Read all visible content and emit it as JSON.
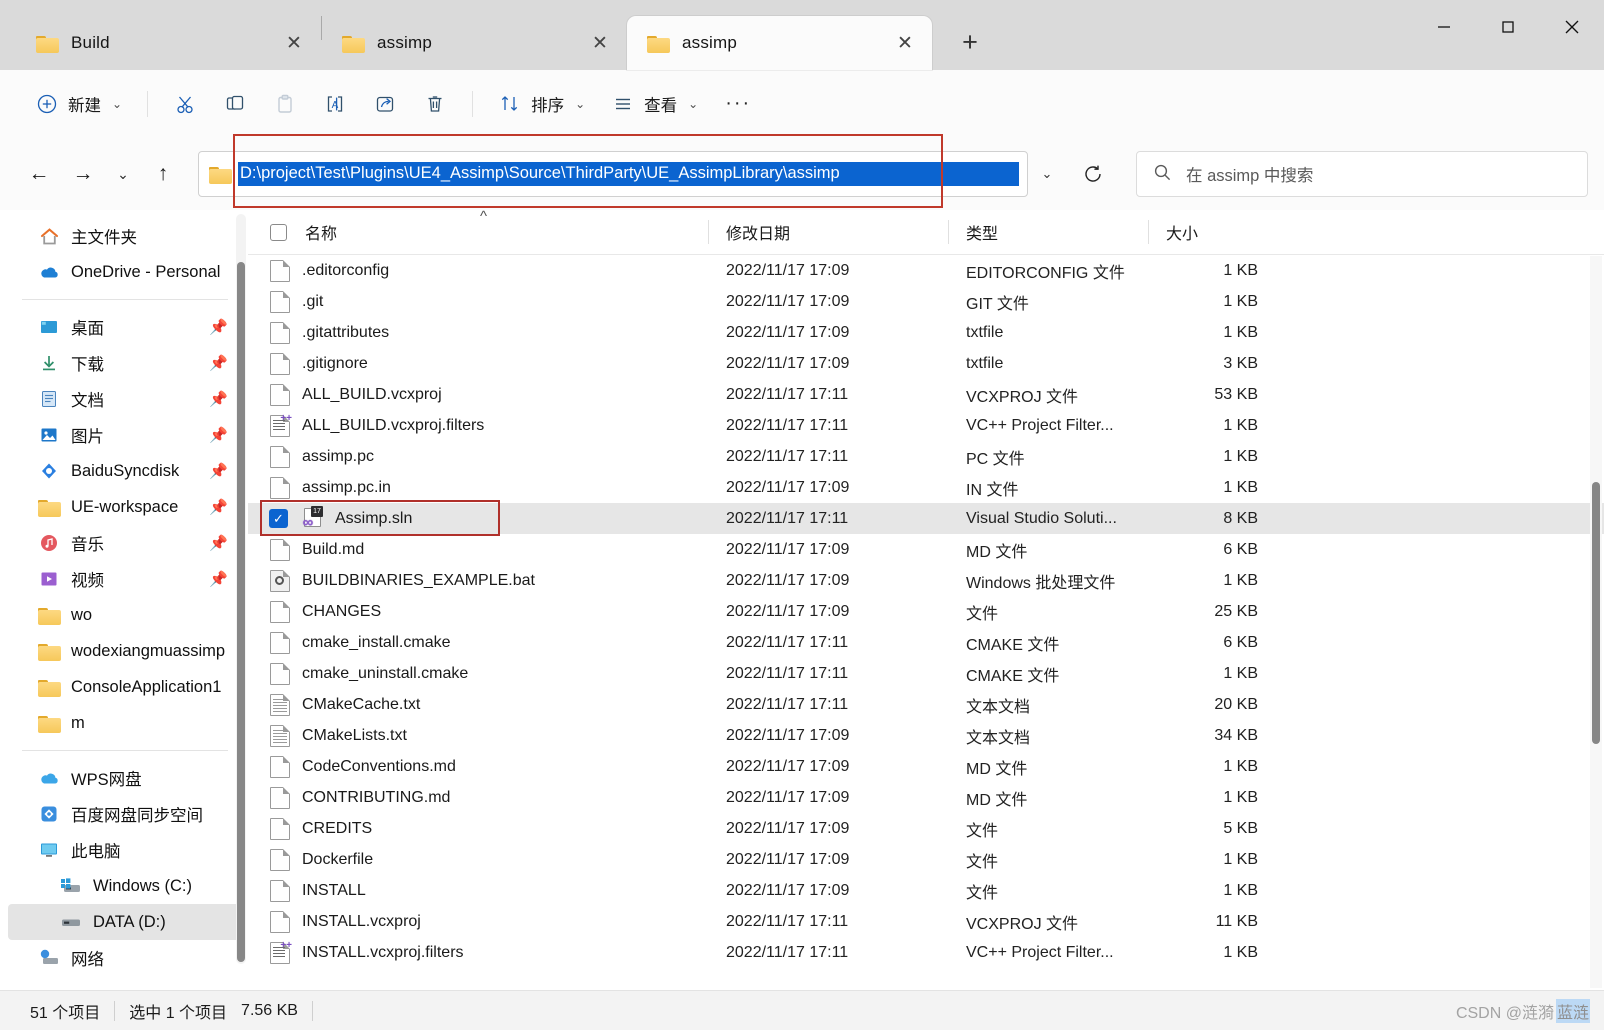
{
  "window": {
    "controls": {
      "minimize": "minimize-button",
      "maximize": "maximize-button",
      "close": "close-button"
    }
  },
  "tabs": [
    {
      "title": "Build",
      "icon": "folder-icon",
      "active": false
    },
    {
      "title": "assimp",
      "icon": "folder-icon",
      "active": false
    },
    {
      "title": "assimp",
      "icon": "folder-icon",
      "active": true
    }
  ],
  "new_tab_label": "+",
  "toolbar": {
    "new_label": "新建",
    "cut_label": "剪切",
    "copy_label": "复制",
    "paste_label": "粘贴",
    "rename_label": "重命名",
    "share_label": "共享",
    "delete_label": "删除",
    "sort_label": "排序",
    "view_label": "查看",
    "more_label": "···"
  },
  "navigation": {
    "back": "←",
    "forward": "→",
    "recent": "⌄",
    "up": "↑",
    "address_value": "D:\\project\\Test\\Plugins\\UE4_Assimp\\Source\\ThirdParty\\UE_AssimpLibrary\\assimp",
    "address_dropdown": "⌄",
    "refresh": "refresh-icon",
    "search_placeholder": "在 assimp 中搜索"
  },
  "sidebar": {
    "groups": [
      {
        "items": [
          {
            "label": "主文件夹",
            "icon": "home-icon",
            "pinned": false,
            "indent": false,
            "selected": false
          },
          {
            "label": "OneDrive - Personal",
            "icon": "onedrive-icon",
            "pinned": false,
            "indent": false,
            "selected": false
          }
        ]
      },
      {
        "items": [
          {
            "label": "桌面",
            "icon": "desktop-icon",
            "pinned": true,
            "indent": false,
            "selected": false
          },
          {
            "label": "下载",
            "icon": "downloads-icon",
            "pinned": true,
            "indent": false,
            "selected": false
          },
          {
            "label": "文档",
            "icon": "documents-icon",
            "pinned": true,
            "indent": false,
            "selected": false
          },
          {
            "label": "图片",
            "icon": "pictures-icon",
            "pinned": true,
            "indent": false,
            "selected": false
          },
          {
            "label": "BaiduSyncdisk",
            "icon": "baidu-icon",
            "pinned": true,
            "indent": false,
            "selected": false
          },
          {
            "label": "UE-workspace",
            "icon": "folder-icon",
            "pinned": true,
            "indent": false,
            "selected": false
          },
          {
            "label": "音乐",
            "icon": "music-icon",
            "pinned": true,
            "indent": false,
            "selected": false
          },
          {
            "label": "视频",
            "icon": "videos-icon",
            "pinned": true,
            "indent": false,
            "selected": false
          },
          {
            "label": "wo",
            "icon": "folder-icon",
            "pinned": false,
            "indent": false,
            "selected": false
          },
          {
            "label": "wodexiangmuassimp",
            "icon": "folder-icon",
            "pinned": false,
            "indent": false,
            "selected": false
          },
          {
            "label": "ConsoleApplication1",
            "icon": "folder-icon",
            "pinned": false,
            "indent": false,
            "selected": false
          },
          {
            "label": "m",
            "icon": "folder-shortcut-icon",
            "pinned": false,
            "indent": false,
            "selected": false
          }
        ]
      },
      {
        "items": [
          {
            "label": "WPS网盘",
            "icon": "wps-cloud-icon",
            "pinned": false,
            "indent": false,
            "selected": false
          },
          {
            "label": "百度网盘同步空间",
            "icon": "baidu-cloud-icon",
            "pinned": false,
            "indent": false,
            "selected": false
          },
          {
            "label": "此电脑",
            "icon": "this-pc-icon",
            "pinned": false,
            "indent": false,
            "selected": false
          },
          {
            "label": "Windows (C:)",
            "icon": "windows-drive-icon",
            "pinned": false,
            "indent": true,
            "selected": false
          },
          {
            "label": "DATA (D:)",
            "icon": "drive-icon",
            "pinned": false,
            "indent": true,
            "selected": true
          },
          {
            "label": "网络",
            "icon": "network-icon",
            "pinned": false,
            "indent": false,
            "selected": false
          }
        ]
      }
    ]
  },
  "file_list": {
    "columns": [
      "名称",
      "修改日期",
      "类型",
      "大小"
    ],
    "sort_indicator": "^",
    "rows": [
      {
        "name": ".editorconfig",
        "date": "2022/11/17 17:09",
        "type": "EDITORCONFIG 文件",
        "size": "1 KB",
        "icon": "file-icon",
        "selected": false,
        "checked": false
      },
      {
        "name": ".git",
        "date": "2022/11/17 17:09",
        "type": "GIT 文件",
        "size": "1 KB",
        "icon": "file-icon",
        "selected": false,
        "checked": false
      },
      {
        "name": ".gitattributes",
        "date": "2022/11/17 17:09",
        "type": "txtfile",
        "size": "1 KB",
        "icon": "file-icon",
        "selected": false,
        "checked": false
      },
      {
        "name": ".gitignore",
        "date": "2022/11/17 17:09",
        "type": "txtfile",
        "size": "3 KB",
        "icon": "file-icon",
        "selected": false,
        "checked": false
      },
      {
        "name": "ALL_BUILD.vcxproj",
        "date": "2022/11/17 17:11",
        "type": "VCXPROJ 文件",
        "size": "53 KB",
        "icon": "file-icon",
        "selected": false,
        "checked": false
      },
      {
        "name": "ALL_BUILD.vcxproj.filters",
        "date": "2022/11/17 17:11",
        "type": "VC++ Project Filter...",
        "size": "1 KB",
        "icon": "filters-icon",
        "selected": false,
        "checked": false
      },
      {
        "name": "assimp.pc",
        "date": "2022/11/17 17:11",
        "type": "PC 文件",
        "size": "1 KB",
        "icon": "file-icon",
        "selected": false,
        "checked": false
      },
      {
        "name": "assimp.pc.in",
        "date": "2022/11/17 17:09",
        "type": "IN 文件",
        "size": "1 KB",
        "icon": "file-icon",
        "selected": false,
        "checked": false
      },
      {
        "name": "Assimp.sln",
        "date": "2022/11/17 17:11",
        "type": "Visual Studio Soluti...",
        "size": "8 KB",
        "icon": "visual-studio-icon",
        "selected": true,
        "checked": true
      },
      {
        "name": "Build.md",
        "date": "2022/11/17 17:09",
        "type": "MD 文件",
        "size": "6 KB",
        "icon": "file-icon",
        "selected": false,
        "checked": false
      },
      {
        "name": "BUILDBINARIES_EXAMPLE.bat",
        "date": "2022/11/17 17:09",
        "type": "Windows 批处理文件",
        "size": "1 KB",
        "icon": "bat-icon",
        "selected": false,
        "checked": false
      },
      {
        "name": "CHANGES",
        "date": "2022/11/17 17:09",
        "type": "文件",
        "size": "25 KB",
        "icon": "file-icon",
        "selected": false,
        "checked": false
      },
      {
        "name": "cmake_install.cmake",
        "date": "2022/11/17 17:11",
        "type": "CMAKE 文件",
        "size": "6 KB",
        "icon": "file-icon",
        "selected": false,
        "checked": false
      },
      {
        "name": "cmake_uninstall.cmake",
        "date": "2022/11/17 17:11",
        "type": "CMAKE 文件",
        "size": "1 KB",
        "icon": "file-icon",
        "selected": false,
        "checked": false
      },
      {
        "name": "CMakeCache.txt",
        "date": "2022/11/17 17:11",
        "type": "文本文档",
        "size": "20 KB",
        "icon": "text-icon",
        "selected": false,
        "checked": false
      },
      {
        "name": "CMakeLists.txt",
        "date": "2022/11/17 17:09",
        "type": "文本文档",
        "size": "34 KB",
        "icon": "text-icon",
        "selected": false,
        "checked": false
      },
      {
        "name": "CodeConventions.md",
        "date": "2022/11/17 17:09",
        "type": "MD 文件",
        "size": "1 KB",
        "icon": "file-icon",
        "selected": false,
        "checked": false
      },
      {
        "name": "CONTRIBUTING.md",
        "date": "2022/11/17 17:09",
        "type": "MD 文件",
        "size": "1 KB",
        "icon": "file-icon",
        "selected": false,
        "checked": false
      },
      {
        "name": "CREDITS",
        "date": "2022/11/17 17:09",
        "type": "文件",
        "size": "5 KB",
        "icon": "file-icon",
        "selected": false,
        "checked": false
      },
      {
        "name": "Dockerfile",
        "date": "2022/11/17 17:09",
        "type": "文件",
        "size": "1 KB",
        "icon": "file-icon",
        "selected": false,
        "checked": false
      },
      {
        "name": "INSTALL",
        "date": "2022/11/17 17:09",
        "type": "文件",
        "size": "1 KB",
        "icon": "file-icon",
        "selected": false,
        "checked": false
      },
      {
        "name": "INSTALL.vcxproj",
        "date": "2022/11/17 17:11",
        "type": "VCXPROJ 文件",
        "size": "11 KB",
        "icon": "file-icon",
        "selected": false,
        "checked": false
      },
      {
        "name": "INSTALL.vcxproj.filters",
        "date": "2022/11/17 17:11",
        "type": "VC++ Project Filter...",
        "size": "1 KB",
        "icon": "filters-icon",
        "selected": false,
        "checked": false
      }
    ]
  },
  "status": {
    "item_count": "51 个项目",
    "selection": "选中 1 个项目",
    "selection_size": "7.56 KB"
  },
  "watermark": {
    "prefix": "CSDN @涟漪",
    "highlight": "蓝涟"
  },
  "colors": {
    "accent": "#0b64d0",
    "annotation": "#b0302b",
    "selection_row": "#e6e6e6",
    "folder": "#f6c85a"
  }
}
